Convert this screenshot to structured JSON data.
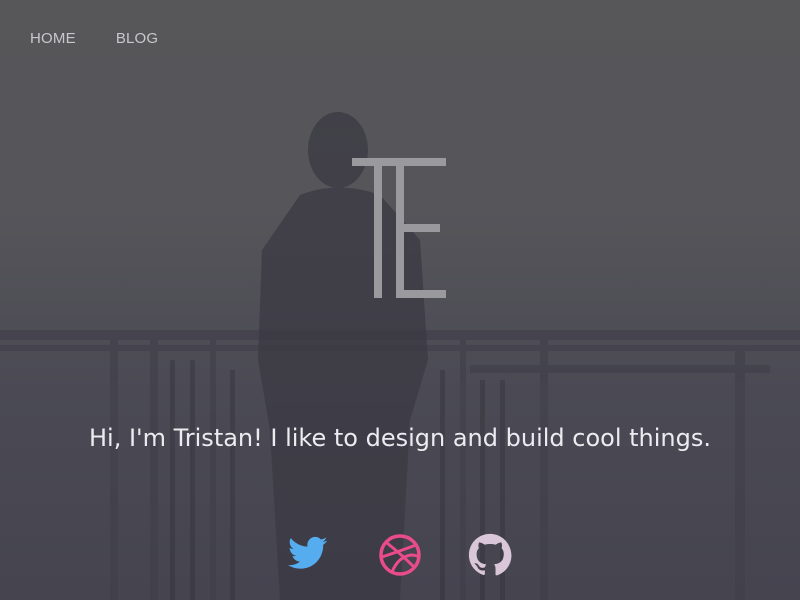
{
  "nav": {
    "items": [
      {
        "label": "HOME"
      },
      {
        "label": "BLOG"
      }
    ]
  },
  "logo": {
    "text": "TE"
  },
  "hero": {
    "tagline": "Hi, I'm Tristan! I like to design and build cool things."
  },
  "social": [
    {
      "icon": "twitter-icon",
      "color": "#55acee"
    },
    {
      "icon": "dribbble-icon",
      "color": "#ea4c89"
    },
    {
      "icon": "github-icon",
      "color": "#d9c6d9"
    }
  ]
}
